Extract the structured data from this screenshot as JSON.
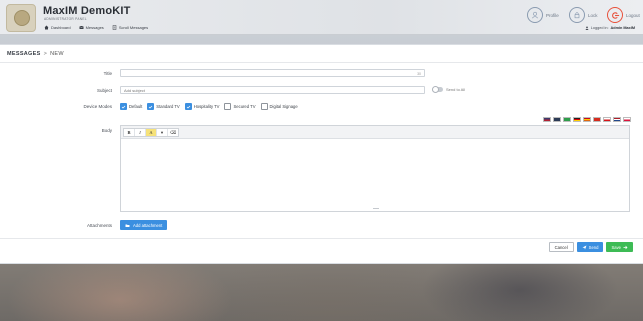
{
  "header": {
    "app_title": "MaxIM DemoKIT",
    "app_subtitle": "ADMINISTRATOR PANEL",
    "nav": [
      {
        "label": "Dashboard",
        "icon": "home-icon"
      },
      {
        "label": "Messages",
        "icon": "envelope-icon"
      },
      {
        "label": "Scroll Messages",
        "icon": "scroll-icon"
      }
    ],
    "profile_label": "Profile",
    "lock_label": "Lock",
    "logout_label": "Logout",
    "logged_in_prefix": "Logged in:",
    "logged_in_user": "Admin MaxIM"
  },
  "breadcrumb": {
    "section": "MESSAGES",
    "separator": ">",
    "current": "NEW"
  },
  "form": {
    "title_label": "Title",
    "title_value": "",
    "title_counter": "30",
    "subject_label": "Subject",
    "subject_placeholder": "Add subject",
    "send_to_all_label": "Send to All",
    "send_to_all_on": false,
    "device_modes_label": "Device Modes",
    "device_modes": [
      {
        "label": "Default",
        "checked": true
      },
      {
        "label": "Standard TV",
        "checked": true
      },
      {
        "label": "Hospitality TV",
        "checked": true
      },
      {
        "label": "Secured TV",
        "checked": false
      },
      {
        "label": "Digital Signage",
        "checked": false
      }
    ],
    "body_label": "Body",
    "toolbar": {
      "bold": "B",
      "italic": "I",
      "font_color": "A",
      "dropdown": "▾",
      "remove_format": "⌫"
    },
    "attachments_label": "Attachments",
    "add_attachment_label": "Add attachment"
  },
  "flags": [
    {
      "name": "us-flag",
      "colors": [
        "#3c3b6e",
        "#b22234"
      ]
    },
    {
      "name": "dark-flag",
      "colors": [
        "#2b3a55",
        "#2b3a55"
      ]
    },
    {
      "name": "green-flag",
      "colors": [
        "#2e9d4a",
        "#2e9d4a"
      ]
    },
    {
      "name": "de-flag",
      "colors": [
        "#222222",
        "#dd0000"
      ]
    },
    {
      "name": "es-flag",
      "colors": [
        "#c60b1e",
        "#ffc400"
      ]
    },
    {
      "name": "red-flag",
      "colors": [
        "#d52b1e",
        "#d52b1e"
      ]
    },
    {
      "name": "cz-flag",
      "colors": [
        "#ffffff",
        "#d7141a"
      ]
    },
    {
      "name": "nl-flag",
      "colors": [
        "#ae1c28",
        "#21468b"
      ]
    },
    {
      "name": "pl-flag",
      "colors": [
        "#ffffff",
        "#dc143c"
      ]
    }
  ],
  "footer": {
    "cancel_label": "Cancel",
    "send_label": "Send",
    "save_label": "Save"
  },
  "colors": {
    "primary": "#3b8fe0",
    "success": "#3dbb55",
    "accent_logout": "#e8503a"
  }
}
